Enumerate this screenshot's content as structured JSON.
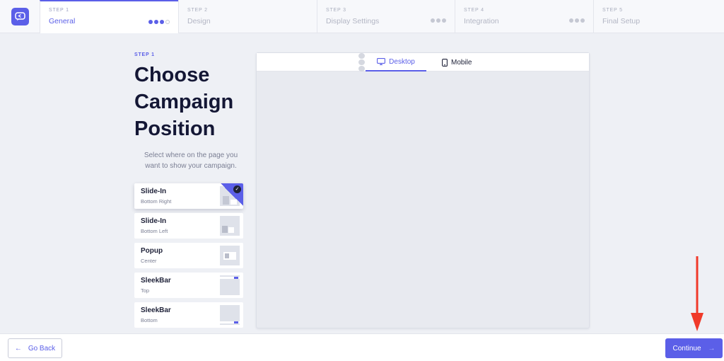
{
  "steps": [
    {
      "num": "STEP 1",
      "title": "General"
    },
    {
      "num": "STEP 2",
      "title": "Design"
    },
    {
      "num": "STEP 3",
      "title": "Display Settings"
    },
    {
      "num": "STEP 4",
      "title": "Integration"
    },
    {
      "num": "STEP 5",
      "title": "Final Setup"
    }
  ],
  "left": {
    "step_label": "STEP 1",
    "heading_line1": "Choose",
    "heading_line2": "Campaign",
    "heading_line3": "Position",
    "subtitle": "Select where on the page you want to show your campaign."
  },
  "options": [
    {
      "title": "Slide-In",
      "sub": "Bottom Right",
      "selected": true
    },
    {
      "title": "Slide-In",
      "sub": "Bottom Left"
    },
    {
      "title": "Popup",
      "sub": "Center"
    },
    {
      "title": "SleekBar",
      "sub": "Top"
    },
    {
      "title": "SleekBar",
      "sub": "Bottom"
    }
  ],
  "preview": {
    "tab_desktop": "Desktop",
    "tab_mobile": "Mobile"
  },
  "footer": {
    "back_label": "Go Back",
    "continue_label": "Continue"
  },
  "colors": {
    "accent": "#5b5fe8",
    "annotation": "#f03a2a"
  }
}
